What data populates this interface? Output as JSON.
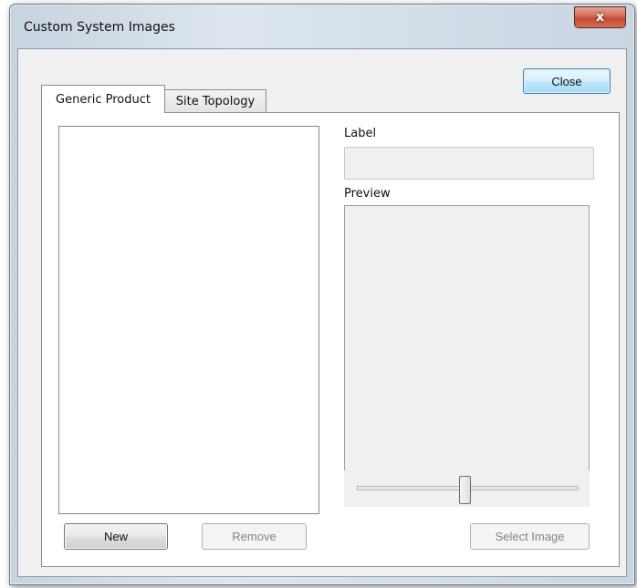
{
  "window": {
    "title": "Custom System Images",
    "close_glyph": "x"
  },
  "toolbar": {
    "close_label": "Close"
  },
  "tabs": [
    {
      "label": "Generic Product",
      "selected": true
    },
    {
      "label": "Site Topology",
      "selected": false
    }
  ],
  "details": {
    "label_caption": "Label",
    "label_value": "",
    "preview_caption": "Preview",
    "zoom_level": 0.5
  },
  "actions": {
    "new_label": "New",
    "remove_label": "Remove",
    "select_image_label": "Select Image"
  },
  "icons": {
    "window_close": "close-icon"
  },
  "colors": {
    "close_button_red": "#c74834",
    "default_button_blue": "#a7d9f5"
  }
}
